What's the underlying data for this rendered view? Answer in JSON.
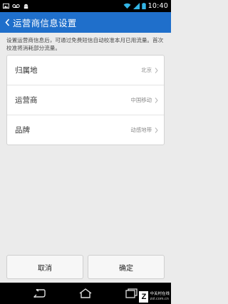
{
  "status_bar": {
    "time": "10:40",
    "icons": [
      "image-icon",
      "voicemail-icon",
      "android-icon",
      "wifi-icon",
      "signal-icon",
      "battery-icon"
    ]
  },
  "title_bar": {
    "title": "运营商信息设置",
    "back_icon": "chevron-left-icon"
  },
  "hint": "设置运营商信息后，可通过免费短信自动校准本月已用流量。首次校准将消耗部分流量。",
  "settings": [
    {
      "label": "归属地",
      "value": "北京"
    },
    {
      "label": "运营商",
      "value": "中国移动"
    },
    {
      "label": "品牌",
      "value": "动感地带"
    }
  ],
  "buttons": {
    "cancel": "取消",
    "confirm": "确定"
  },
  "nav_bar": {
    "icons": [
      "back-icon",
      "home-icon",
      "recent-apps-icon"
    ]
  },
  "watermark": {
    "logo": "Z",
    "line1": "中关村在线",
    "line2": "zol.com.cn"
  },
  "colors": {
    "accent": "#1f6fcb",
    "background": "#ebebeb"
  }
}
